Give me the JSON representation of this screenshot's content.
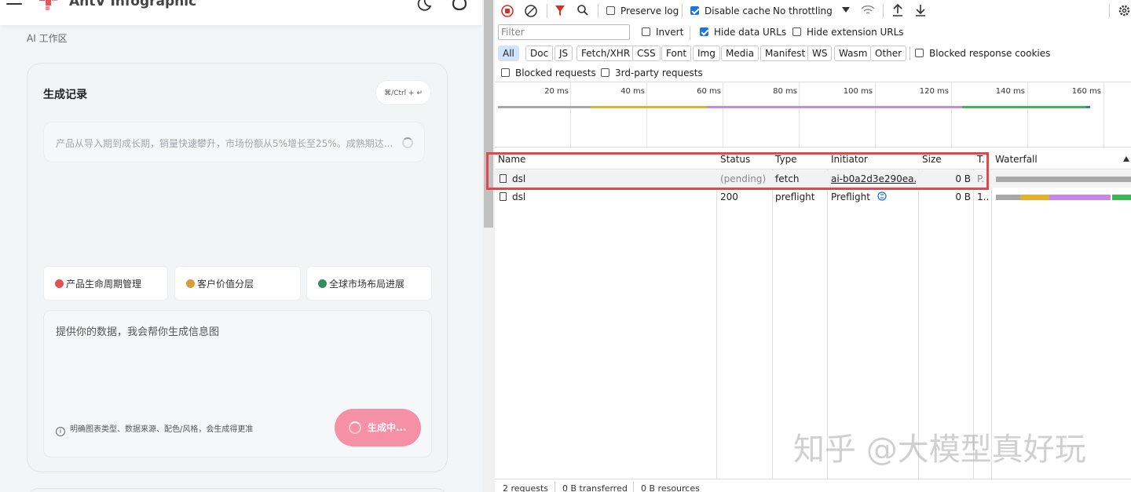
{
  "app": {
    "title": "AntV Infographic",
    "breadcrumb": "AI 工作区",
    "card_title": "生成记录",
    "shortcut": "⌘/Ctrl + ↵",
    "history_item": "产品从导入期到成长期，销量快速攀升，市场份额从5%增长至25%。成熟期达...",
    "chips": [
      {
        "label": "产品生命周期管理",
        "color": "#e05252"
      },
      {
        "label": "客户价值分层",
        "color": "#d89a3a"
      },
      {
        "label": "全球市场布局进展",
        "color": "#2f8f5b"
      }
    ],
    "input_placeholder": "提供你的数据，我会帮你生成信息图",
    "hint": "明确图表类型、数据来源、配色/风格，会生成得更准",
    "generate_label": "生成中..."
  },
  "devtools": {
    "toolbar": {
      "preserve_log": "Preserve log",
      "disable_cache": "Disable cache",
      "throttling": "No throttling"
    },
    "filter": {
      "placeholder": "Filter",
      "invert": "Invert",
      "hide_data_urls": "Hide data URLs",
      "hide_extension_urls": "Hide extension URLs"
    },
    "type_filters": [
      "All",
      "Doc",
      "JS",
      "Fetch/XHR",
      "CSS",
      "Font",
      "Img",
      "Media",
      "Manifest",
      "WS",
      "Wasm",
      "Other"
    ],
    "blocked_response_cookies": "Blocked response cookies",
    "blocked_requests": "Blocked requests",
    "third_party": "3rd-party requests",
    "timeline_ticks": [
      "20 ms",
      "40 ms",
      "60 ms",
      "80 ms",
      "100 ms",
      "120 ms",
      "140 ms",
      "160 ms"
    ],
    "columns": {
      "name": "Name",
      "status": "Status",
      "type": "Type",
      "initiator": "Initiator",
      "size": "Size",
      "time": "T.",
      "waterfall": "Waterfall"
    },
    "rows": [
      {
        "name": "dsl",
        "status": "(pending)",
        "type": "fetch",
        "initiator": "ai-b0a2d3e290ea...",
        "size": "0 B",
        "time": "P."
      },
      {
        "name": "dsl",
        "status": "200",
        "type": "preflight",
        "initiator": "Preflight",
        "size": "0 B",
        "time": "1..."
      }
    ],
    "status_bar": {
      "requests": "2 requests",
      "transferred": "0 B transferred",
      "resources": "0 B resources"
    }
  },
  "watermark": "知乎 @大模型真好玩"
}
